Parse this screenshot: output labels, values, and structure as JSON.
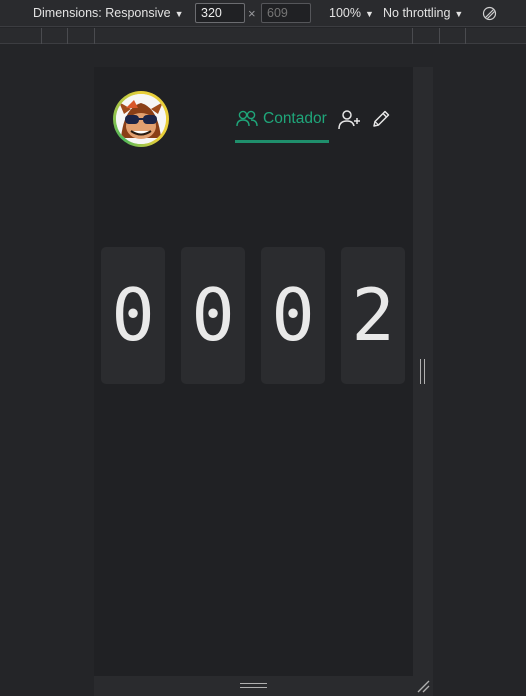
{
  "toolbar": {
    "dimensions_label": "Dimensions: Responsive",
    "width_value": "320",
    "height_placeholder": "609",
    "times_symbol": "×",
    "zoom_label": "100%",
    "throttling_label": "No throttling",
    "caret": "▼"
  },
  "app": {
    "nav_label": "Contador",
    "accent_color": "#1fa67a",
    "icons": [
      "avatar",
      "users-icon",
      "add-user-icon",
      "edit-icon"
    ]
  },
  "counter": {
    "digits": [
      "0",
      "0",
      "0",
      "2"
    ]
  }
}
